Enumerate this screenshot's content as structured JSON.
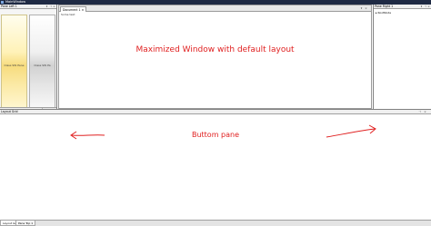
{
  "window": {
    "title": "MainWindow"
  },
  "left_pane": {
    "title": "Pane Left 1",
    "panel_yellow_label": "Class SW Pane",
    "panel_gray_label": "Class SW Pa",
    "tabs": [
      "Pane Left",
      "Pane Left",
      "Pane Left"
    ]
  },
  "document": {
    "tab_label": "Document 1",
    "body_text": "Some text",
    "message": "Maximized Window with default layout"
  },
  "right_pane": {
    "title": "Pane Right 1",
    "tree_items": [
      "RootNode"
    ]
  },
  "bottom_pane": {
    "title": "Layout Grid",
    "message": "Buttom pane",
    "tabs": [
      "Layout Grid",
      "Pane Top 1"
    ]
  },
  "colors": {
    "annotation": "#e02020",
    "title_bar": "#1f2a44"
  }
}
